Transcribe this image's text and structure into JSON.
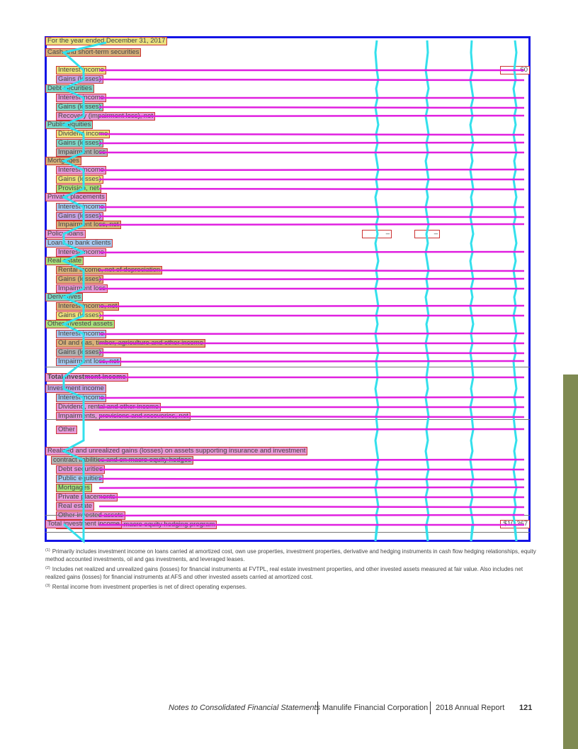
{
  "header_row": {
    "label": "For the year ended December 31, 2017",
    "cols": [
      "",
      "",
      "",
      ""
    ]
  },
  "rows": [
    {
      "label": "Cash and short-term securities",
      "level": "sec",
      "values": [
        "",
        "",
        "",
        ""
      ],
      "hl": "hl-tan"
    },
    {
      "label": "Interest income",
      "level": "sub",
      "values": [
        "",
        "",
        "",
        "60"
      ],
      "hl": "hl-yellow"
    },
    {
      "label": "Gains (losses)",
      "level": "sub",
      "values": [
        "",
        "",
        "",
        ""
      ],
      "hl": "hl-lilac"
    },
    {
      "label": "Debt securities",
      "level": "sec",
      "values": [
        "",
        "",
        "",
        ""
      ],
      "hl": "hl-teal"
    },
    {
      "label": "Interest income",
      "level": "sub",
      "values": [
        "",
        "",
        "",
        ""
      ],
      "hl": "hl-pink"
    },
    {
      "label": "Gains (losses)",
      "level": "sub",
      "values": [
        "",
        "",
        "",
        ""
      ],
      "hl": "hl-teal"
    },
    {
      "label": "Recovery (impairment loss), net",
      "level": "sub",
      "values": [
        "",
        "",
        "",
        ""
      ],
      "hl": "hl-pink"
    },
    {
      "label": "Public equities",
      "level": "sec",
      "values": [
        "",
        "",
        "",
        ""
      ],
      "hl": "hl-teal"
    },
    {
      "label": "Dividend income",
      "level": "sub",
      "values": [
        "",
        "",
        "",
        ""
      ],
      "hl": "hl-yellow"
    },
    {
      "label": "Gains (losses)",
      "level": "sub",
      "values": [
        "",
        "",
        "",
        ""
      ],
      "hl": "hl-teal"
    },
    {
      "label": "Impairment loss",
      "level": "sub",
      "values": [
        "",
        "",
        "",
        ""
      ],
      "hl": "hl-gray"
    },
    {
      "label": "Mortgages",
      "level": "sec",
      "values": [
        "",
        "",
        "",
        ""
      ],
      "hl": "hl-tan"
    },
    {
      "label": "Interest income",
      "level": "sub",
      "values": [
        "",
        "",
        "",
        ""
      ],
      "hl": "hl-pink"
    },
    {
      "label": "Gains (losses)",
      "level": "sub",
      "values": [
        "",
        "",
        "",
        ""
      ],
      "hl": "hl-yellow"
    },
    {
      "label": "Provision, net",
      "level": "sub",
      "values": [
        "",
        "",
        "",
        ""
      ],
      "hl": "hl-green"
    },
    {
      "label": "Private placements",
      "level": "sec",
      "values": [
        "",
        "",
        "",
        ""
      ],
      "hl": "hl-pink"
    },
    {
      "label": "Interest income",
      "level": "sub",
      "values": [
        "",
        "",
        "",
        ""
      ],
      "hl": "hl-blue"
    },
    {
      "label": "Gains (losses)",
      "level": "sub",
      "values": [
        "",
        "",
        "",
        ""
      ],
      "hl": "hl-lilac"
    },
    {
      "label": "Impairment loss, net",
      "level": "sub",
      "values": [
        "",
        "",
        "",
        ""
      ],
      "hl": "hl-tan"
    },
    {
      "label": "Policy loans",
      "level": "sec",
      "values": [
        "–",
        "–",
        "",
        ""
      ],
      "hl": "hl-pink"
    },
    {
      "label": "Loans to bank clients",
      "level": "sec",
      "values": [
        "",
        "",
        "",
        ""
      ],
      "hl": "hl-blue"
    },
    {
      "label": "Interest income",
      "level": "sub",
      "values": [
        "",
        "",
        "",
        ""
      ],
      "hl": "hl-pink"
    },
    {
      "label": "Real estate",
      "level": "sec",
      "values": [
        "",
        "",
        "",
        ""
      ],
      "hl": "hl-green"
    },
    {
      "label": "Rental income, net of depreciation",
      "level": "sub",
      "values": [
        "",
        "",
        "",
        ""
      ],
      "hl": "hl-tan"
    },
    {
      "label": "Gains (losses)",
      "level": "sub",
      "values": [
        "",
        "",
        "",
        ""
      ],
      "hl": "hl-tan"
    },
    {
      "label": "Impairment loss",
      "level": "sub",
      "values": [
        "",
        "",
        "",
        ""
      ],
      "hl": "hl-pink"
    },
    {
      "label": "Derivatives",
      "level": "sec",
      "values": [
        "",
        "",
        "",
        ""
      ],
      "hl": "hl-teal"
    },
    {
      "label": "Interest income, net",
      "level": "sub",
      "values": [
        "",
        "",
        "",
        ""
      ],
      "hl": "hl-tan"
    },
    {
      "label": "Gains (losses)",
      "level": "sub",
      "values": [
        "",
        "",
        "",
        ""
      ],
      "hl": "hl-yellow"
    },
    {
      "label": "Other invested assets",
      "level": "sec",
      "values": [
        "",
        "",
        "",
        ""
      ],
      "hl": "hl-green"
    },
    {
      "label": "Interest income",
      "level": "sub",
      "values": [
        "",
        "",
        "",
        ""
      ],
      "hl": "hl-blue"
    },
    {
      "label": "Oil and gas, timber, agriculture and other income",
      "level": "sub",
      "values": [
        "",
        "",
        "",
        ""
      ],
      "hl": "hl-tan"
    },
    {
      "label": "Gains (losses)",
      "level": "sub",
      "values": [
        "",
        "",
        "",
        ""
      ],
      "hl": "hl-gray"
    },
    {
      "label": "Impairment loss, net",
      "level": "sub",
      "values": [
        "",
        "",
        "",
        ""
      ],
      "hl": "hl-blue"
    },
    {
      "label": "Total investment income",
      "level": "sec",
      "bold": true,
      "values": [
        "",
        "",
        "",
        ""
      ],
      "hl": "hl-pink"
    },
    {
      "label": "Investment income",
      "level": "sec",
      "values": [
        "",
        "",
        "",
        ""
      ],
      "hl": "hl-lilac"
    },
    {
      "label": "Interest income",
      "level": "sub",
      "values": [
        "",
        "",
        "",
        ""
      ],
      "hl": "hl-blue"
    },
    {
      "label": "Dividend, rental and other income",
      "level": "sub",
      "values": [
        "",
        "",
        "",
        ""
      ],
      "hl": "hl-pink"
    },
    {
      "label": "Impairments, provisions and recoveries, net",
      "level": "sub",
      "values": [
        "",
        "",
        "",
        ""
      ],
      "hl": "hl-pink"
    },
    {
      "label": "Other",
      "level": "sub",
      "values": [
        "",
        "",
        "",
        ""
      ],
      "hl": "hl-pink"
    },
    {
      "label": "",
      "level": "sub",
      "values": [
        "",
        "",
        "",
        ""
      ],
      "hl": ""
    },
    {
      "label": "Realized and unrealized gains (losses) on assets supporting insurance and investment",
      "level": "sec",
      "values": [
        "",
        "",
        "",
        ""
      ],
      "hl": "hl-pink"
    },
    {
      "label": "contract liabilities and on macro equity hedges",
      "level": "ind",
      "values": [
        "",
        "",
        "",
        ""
      ],
      "hl": "hl-gray"
    },
    {
      "label": "Debt securities",
      "level": "sub",
      "values": [
        "",
        "",
        "",
        ""
      ],
      "hl": "hl-pink"
    },
    {
      "label": "Public equities",
      "level": "sub",
      "values": [
        "",
        "",
        "",
        ""
      ],
      "hl": "hl-blue"
    },
    {
      "label": "Mortgages",
      "level": "sub",
      "values": [
        "",
        "",
        "",
        ""
      ],
      "hl": "hl-green"
    },
    {
      "label": "Private placements",
      "level": "sub",
      "values": [
        "",
        "",
        "",
        ""
      ],
      "hl": "hl-pink"
    },
    {
      "label": "Real estate",
      "level": "sub",
      "values": [
        "",
        "",
        "",
        ""
      ],
      "hl": "hl-pink"
    },
    {
      "label": "Other invested assets",
      "level": "sub",
      "values": [
        "",
        "",
        "",
        ""
      ],
      "hl": "hl-pink"
    },
    {
      "label": "Derivatives, including macro equity hedging program",
      "level": "sub",
      "values": [
        "",
        "",
        "",
        ""
      ],
      "hl": "hl-pink"
    },
    {
      "label": "",
      "level": "sub",
      "values": [
        "",
        "",
        "",
        ""
      ],
      "hl": ""
    },
    {
      "label": "Total investment income",
      "level": "sec",
      "values": [
        "",
        "",
        "",
        "$10,367"
      ],
      "hl": "hl-pink"
    }
  ],
  "footnotes": [
    {
      "mark": "(1)",
      "text": "Primarily includes investment income on loans carried at amortized cost, own use properties, investment properties, derivative and hedging instruments in cash flow hedging relationships, equity method accounted investments, oil and gas investments, and leveraged leases."
    },
    {
      "mark": "(2)",
      "text": "Includes net realized and unrealized gains (losses) for financial instruments at FVTPL, real estate investment properties, and other invested assets measured at fair value. Also includes net realized gains (losses) for financial instruments at AFS and other invested assets carried at amortized cost."
    },
    {
      "mark": "(3)",
      "text": "Rental income from investment properties is net of direct operating expenses."
    }
  ],
  "footer": {
    "section": "Notes to Consolidated Financial Statements",
    "company": "Manulife Financial Corporation",
    "report": "2018 Annual Report",
    "page": "121"
  },
  "colors": {
    "frame": "#1414e6",
    "row_connector": "#e020e0",
    "column_connector": "#33e0ec",
    "side_tab": "#7f8a52"
  }
}
